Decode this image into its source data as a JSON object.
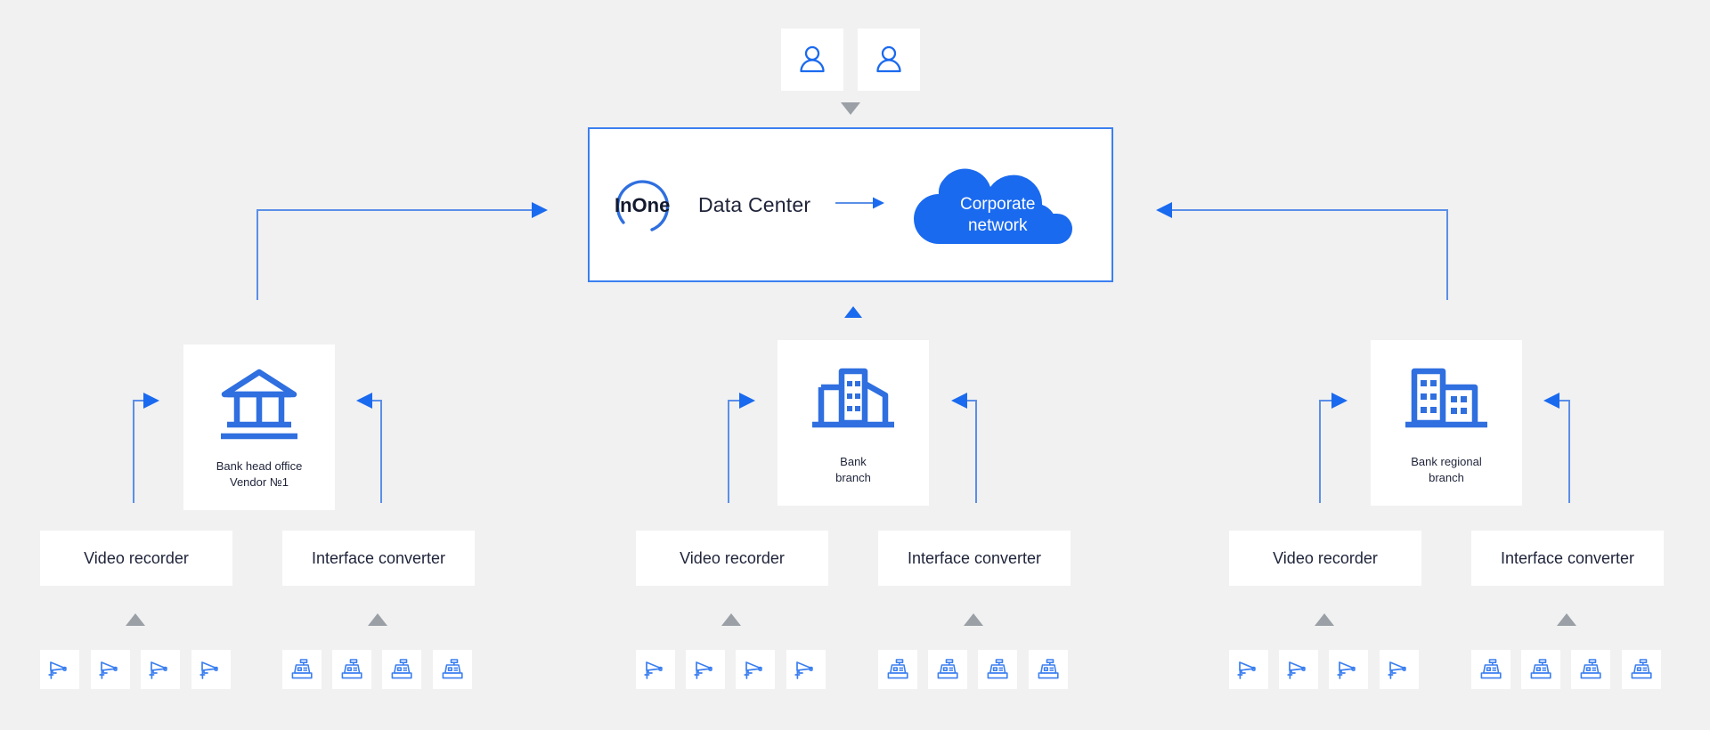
{
  "diagram": {
    "background_color": "#f1f1f1",
    "accent_color": "#1a6aef",
    "line_color": "#5b8fe8",
    "text_color": "#1e2339",
    "gray_marker_color": "#9aa0a6"
  },
  "top_users": [
    {
      "icon": "user-icon",
      "label": ""
    },
    {
      "icon": "user-icon",
      "label": ""
    }
  ],
  "data_center": {
    "logo_text": "InOne",
    "title": "Data Center",
    "cloud_label_line1": "Corporate",
    "cloud_label_line2": "network",
    "cloud_color": "#1a6aef"
  },
  "sites": [
    {
      "id": "bank-head-office",
      "icon": "bank-classical-icon",
      "label_line1": "Bank head office",
      "label_line2": "Vendor №1",
      "devices": [
        {
          "id": "video-recorder",
          "label": "Video recorder",
          "equipment_icon": "cctv-camera-icon",
          "equipment_count": 4
        },
        {
          "id": "interface-converter",
          "label": "Interface converter",
          "equipment_icon": "cash-register-icon",
          "equipment_count": 4
        }
      ]
    },
    {
      "id": "bank-branch",
      "icon": "office-building-icon",
      "label_line1": "Bank",
      "label_line2": "branch",
      "devices": [
        {
          "id": "video-recorder",
          "label": "Video recorder",
          "equipment_icon": "cctv-camera-icon",
          "equipment_count": 4
        },
        {
          "id": "interface-converter",
          "label": "Interface converter",
          "equipment_icon": "cash-register-icon",
          "equipment_count": 4
        }
      ]
    },
    {
      "id": "bank-regional-branch",
      "icon": "twin-building-icon",
      "label_line1": "Bank regional",
      "label_line2": "branch",
      "devices": [
        {
          "id": "video-recorder",
          "label": "Video recorder",
          "equipment_icon": "cctv-camera-icon",
          "equipment_count": 4
        },
        {
          "id": "interface-converter",
          "label": "Interface converter",
          "equipment_icon": "cash-register-icon",
          "equipment_count": 4
        }
      ]
    }
  ]
}
